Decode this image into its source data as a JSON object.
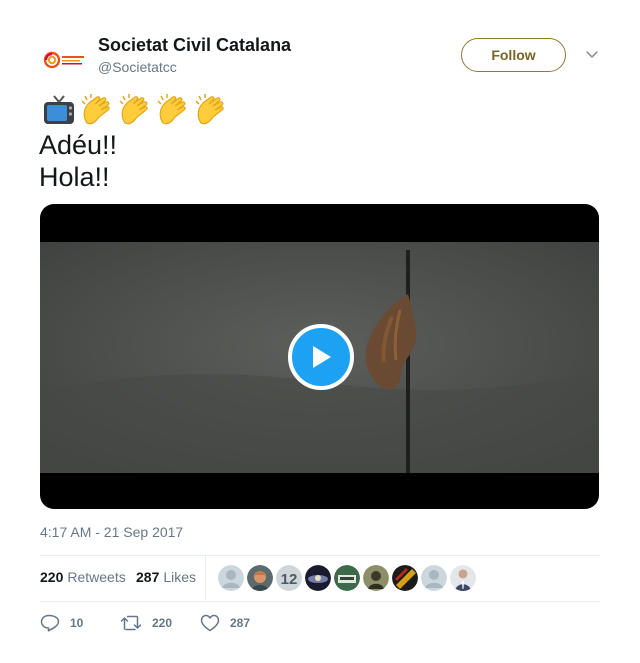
{
  "author": {
    "display_name": "Societat Civil Catalana",
    "handle": "@Societatcc"
  },
  "follow_label": "Follow",
  "tweet": {
    "emoji_icons": [
      "television-emoji",
      "clapping-hands-emoji",
      "clapping-hands-emoji",
      "clapping-hands-emoji",
      "clapping-hands-emoji"
    ],
    "lines": [
      "Adéu!!",
      "Hola!!"
    ]
  },
  "timestamp": "4:17 AM - 21 Sep 2017",
  "stats": {
    "retweets_count": "220",
    "retweets_label": "Retweets",
    "likes_count": "287",
    "likes_label": "Likes"
  },
  "likers": [
    {
      "icon": "default-avatar",
      "color": "#a9b7c1"
    },
    {
      "icon": "user-avatar",
      "color": "#c07a4a"
    },
    {
      "icon": "user-avatar",
      "color": "#7f8d96"
    },
    {
      "icon": "user-avatar",
      "color": "#24253a"
    },
    {
      "icon": "user-avatar",
      "color": "#3e6a4c"
    },
    {
      "icon": "user-avatar",
      "color": "#6b6b45"
    },
    {
      "icon": "user-avatar",
      "color": "#b32a1c"
    },
    {
      "icon": "default-avatar",
      "color": "#a9b7c1"
    },
    {
      "icon": "user-avatar",
      "color": "#4b5d82"
    }
  ],
  "actions": {
    "reply_count": "10",
    "retweet_count": "220",
    "like_count": "287"
  },
  "colors": {
    "accent": "#1da1f2",
    "follow_border": "#8c7a3a",
    "muted_text": "#657786"
  }
}
